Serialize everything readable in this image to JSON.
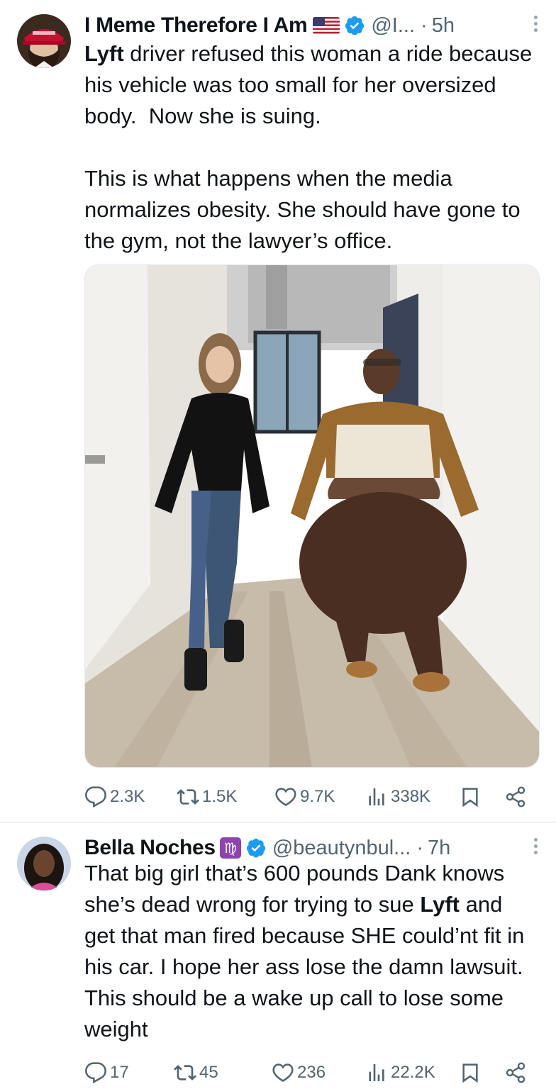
{
  "tweets": [
    {
      "author_name": "I Meme Therefore I Am",
      "handle": "@I...",
      "separator": "·",
      "time": "5h",
      "text_bold_lead": "Lyft",
      "text_rest": " driver refused this woman a ride because his vehicle was too small for her oversized body.  Now she is suing.\n\nThis is what happens when the media normalizes obesity. She should have gone to the gym, not the lawyer’s office.",
      "stats": {
        "replies": "2.3K",
        "retweets": "1.5K",
        "likes": "9.7K",
        "views": "338K"
      }
    },
    {
      "author_name": "Bella Noches",
      "zodiac": "♍",
      "handle": "@beautynbul...",
      "separator": "·",
      "time": "7h",
      "text_part1": "That big girl that’s 600 pounds Dank knows she’s dead wrong for trying to sue ",
      "text_bold": "Lyft",
      "text_part2": " and get that man fired because SHE could’nt fit in his car. I hope her ass lose the damn lawsuit. This should be a wake up call to lose some weight",
      "stats": {
        "replies": "17",
        "retweets": "45",
        "likes": "236",
        "views": "22.2K"
      }
    }
  ],
  "icons": {
    "reply": "reply-icon",
    "retweet": "retweet-icon",
    "like": "heart-icon",
    "views": "views-icon",
    "bookmark": "bookmark-icon",
    "share": "share-icon",
    "verified": "verified-badge-icon",
    "flag": "us-flag-icon"
  },
  "colors": {
    "text": "#0f1419",
    "muted": "#536471",
    "verified": "#1d9bf0",
    "zodiac_badge": "#8e44ad"
  }
}
